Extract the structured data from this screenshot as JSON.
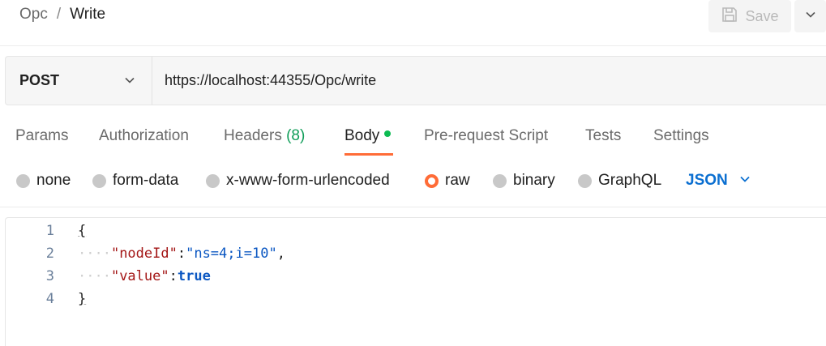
{
  "breadcrumb": {
    "parent": "Opc",
    "separator": "/",
    "current": "Write"
  },
  "save": {
    "label": "Save"
  },
  "request": {
    "method": "POST",
    "url": "https://localhost:44355/Opc/write"
  },
  "tabs": {
    "params": "Params",
    "authorization": "Authorization",
    "headers": "Headers",
    "headers_count": "(8)",
    "body": "Body",
    "prerequest": "Pre-request Script",
    "tests": "Tests",
    "settings": "Settings",
    "active": "Body"
  },
  "body_types": {
    "options": [
      "none",
      "form-data",
      "x-www-form-urlencoded",
      "raw",
      "binary",
      "GraphQL"
    ],
    "selected": "raw",
    "format": "JSON"
  },
  "editor": {
    "line_numbers": [
      "1",
      "2",
      "3",
      "4"
    ],
    "open_brace": "{",
    "close_brace": "}",
    "guide": "····",
    "key1": "\"nodeId\"",
    "value1": "\"ns=4;i=10\"",
    "key2": "\"value\"",
    "value2": "true",
    "colon": ":",
    "comma": ","
  },
  "colors": {
    "accent": "#ff6c37",
    "link": "#0b6fd1",
    "status_dot": "#0cbb52",
    "json_key": "#a31515",
    "json_value": "#0b57c2"
  }
}
